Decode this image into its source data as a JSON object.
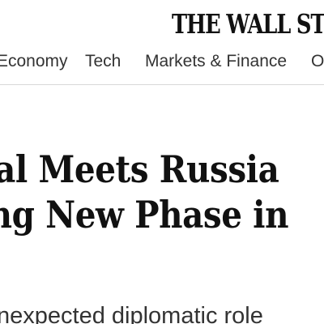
{
  "masthead": {
    "title": "THE WALL STRE"
  },
  "nav": {
    "items": [
      {
        "label": "Economy"
      },
      {
        "label": "Tech"
      },
      {
        "label": "Markets & Finance"
      },
      {
        "label": "O"
      }
    ]
  },
  "article": {
    "headline_line_1": "cial Meets Russia",
    "headline_line_2": "ling New Phase in",
    "dek": "nexpected diplomatic role"
  }
}
